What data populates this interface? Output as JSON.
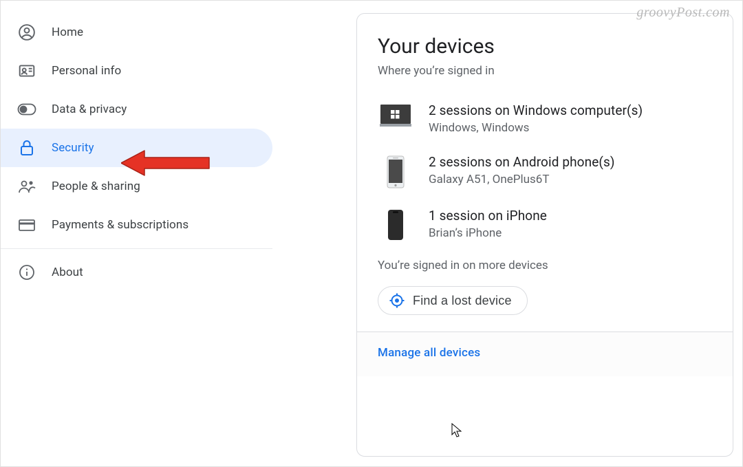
{
  "sidebar": {
    "items": [
      {
        "label": "Home",
        "icon": "user-circle-icon",
        "active": false
      },
      {
        "label": "Personal info",
        "icon": "id-card-icon",
        "active": false
      },
      {
        "label": "Data & privacy",
        "icon": "toggle-icon",
        "active": false
      },
      {
        "label": "Security",
        "icon": "lock-icon",
        "active": true
      },
      {
        "label": "People & sharing",
        "icon": "people-icon",
        "active": false
      },
      {
        "label": "Payments & subscriptions",
        "icon": "card-icon",
        "active": false
      }
    ],
    "about_label": "About"
  },
  "card": {
    "title": "Your devices",
    "subtitle": "Where you’re signed in",
    "devices": [
      {
        "title": "2 sessions on Windows computer(s)",
        "detail": "Windows, Windows",
        "icon": "windows-pc-icon"
      },
      {
        "title": "2 sessions on Android phone(s)",
        "detail": "Galaxy A51, OnePlus6T",
        "icon": "android-phone-icon"
      },
      {
        "title": "1 session on iPhone",
        "detail": "Brian’s iPhone",
        "icon": "iphone-icon"
      }
    ],
    "more_text": "You’re signed in on more devices",
    "find_label": "Find a lost device",
    "manage_label": "Manage all devices"
  },
  "watermark": "groovyPost.com"
}
